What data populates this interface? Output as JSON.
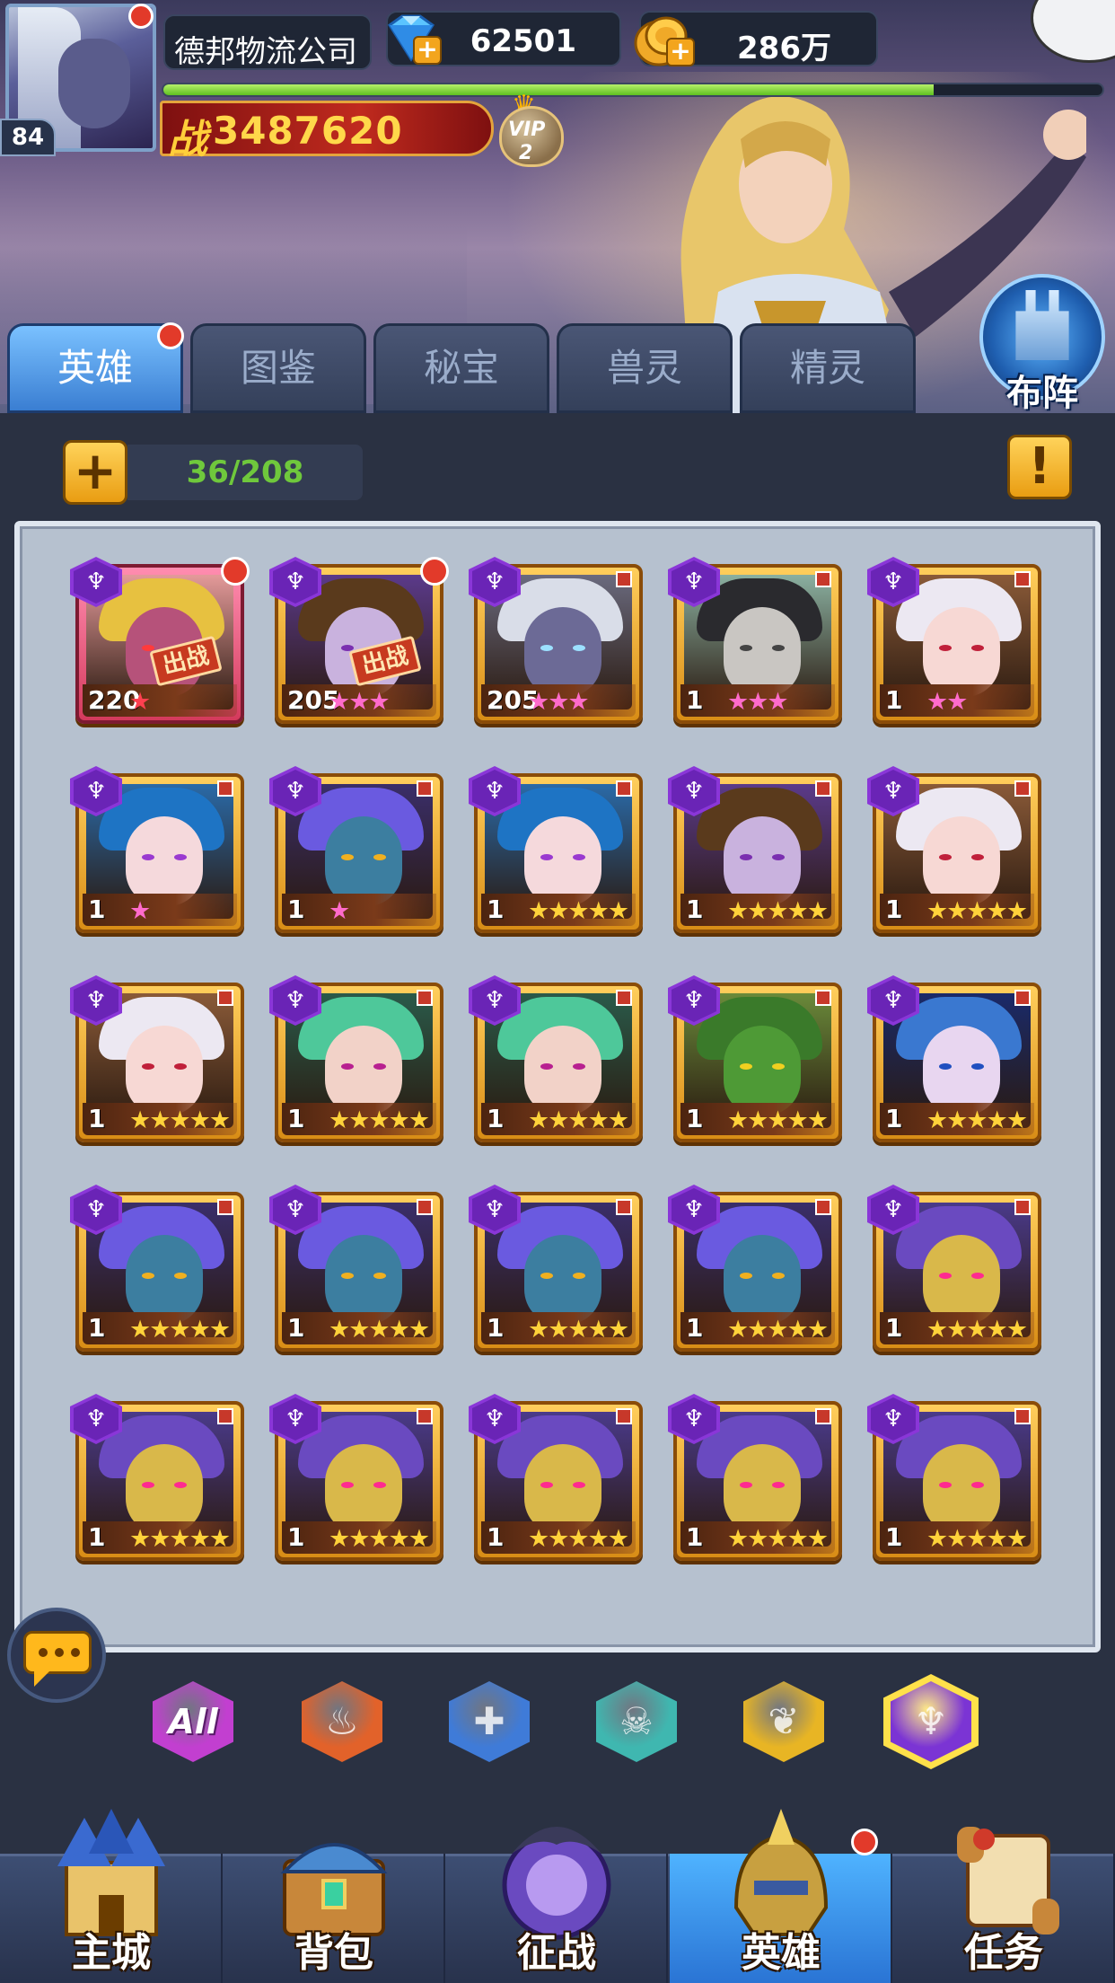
{
  "player": {
    "name": "德邦物流公司",
    "level": "84",
    "gems": "62501",
    "gold": "286万",
    "power_prefix": "战",
    "power": "3487620",
    "vip_label": "VIP",
    "vip_level": "2",
    "exp_fraction": 0.82
  },
  "tabs": [
    {
      "label": "英雄",
      "active": true,
      "badge": true
    },
    {
      "label": "图鉴",
      "active": false,
      "badge": false
    },
    {
      "label": "秘宝",
      "active": false,
      "badge": false
    },
    {
      "label": "兽灵",
      "active": false,
      "badge": false
    },
    {
      "label": "精灵",
      "active": false,
      "badge": false
    }
  ],
  "formation_label": "布阵",
  "hero_count": "36/208",
  "hero_badge_label": "出战",
  "faction_filters": [
    {
      "label": "All",
      "icon": "all-icon",
      "color": "#c23fd0",
      "selected": false
    },
    {
      "label": "",
      "icon": "fire-faction-icon",
      "color": "#e2622a",
      "selected": false
    },
    {
      "label": "",
      "icon": "cross-faction-icon",
      "color": "#3f7bd8",
      "selected": false
    },
    {
      "label": "",
      "icon": "skull-faction-icon",
      "color": "#3fb7b0",
      "selected": false
    },
    {
      "label": "",
      "icon": "wing-faction-icon",
      "color": "#e8b524",
      "selected": false
    },
    {
      "label": "",
      "icon": "trident-faction-icon",
      "color": "#7b34d4",
      "selected": true
    }
  ],
  "heroes": [
    {
      "level": "220",
      "stars": 1,
      "star_color": "#ff4050",
      "theme": "gold-masked",
      "deployed": true,
      "red_dot": true,
      "frame": "red"
    },
    {
      "level": "205",
      "stars": 3,
      "star_color": "#ff6bcb",
      "theme": "purple-warrior",
      "deployed": true,
      "red_dot": true,
      "frame": "gold"
    },
    {
      "level": "205",
      "stars": 3,
      "star_color": "#ff6bcb",
      "theme": "silver-hair",
      "deployed": false,
      "red_dot": false,
      "frame": "gold"
    },
    {
      "level": "1",
      "stars": 3,
      "star_color": "#ff6bcb",
      "theme": "dark-witch",
      "deployed": false,
      "red_dot": false,
      "frame": "gold"
    },
    {
      "level": "1",
      "stars": 2,
      "star_color": "#ff6bcb",
      "theme": "white-elf",
      "deployed": false,
      "red_dot": false,
      "frame": "gold"
    },
    {
      "level": "1",
      "stars": 1,
      "star_color": "#ff6bcb",
      "theme": "blue-hair",
      "deployed": false,
      "red_dot": false,
      "frame": "gold"
    },
    {
      "level": "1",
      "stars": 1,
      "star_color": "#ff6bcb",
      "theme": "blue-spiky",
      "deployed": false,
      "red_dot": false,
      "frame": "gold"
    },
    {
      "level": "1",
      "stars": 5,
      "star_color": "#ffd23a",
      "theme": "blue-hair",
      "deployed": false,
      "red_dot": false,
      "frame": "gold"
    },
    {
      "level": "1",
      "stars": 5,
      "star_color": "#ffd23a",
      "theme": "purple-warrior",
      "deployed": false,
      "red_dot": false,
      "frame": "gold"
    },
    {
      "level": "1",
      "stars": 5,
      "star_color": "#ffd23a",
      "theme": "white-elf",
      "deployed": false,
      "red_dot": false,
      "frame": "gold"
    },
    {
      "level": "1",
      "stars": 5,
      "star_color": "#ffd23a",
      "theme": "white-elf",
      "deployed": false,
      "red_dot": false,
      "frame": "gold"
    },
    {
      "level": "1",
      "stars": 5,
      "star_color": "#ffd23a",
      "theme": "green-hair",
      "deployed": false,
      "red_dot": false,
      "frame": "gold"
    },
    {
      "level": "1",
      "stars": 5,
      "star_color": "#ffd23a",
      "theme": "green-hair",
      "deployed": false,
      "red_dot": false,
      "frame": "gold"
    },
    {
      "level": "1",
      "stars": 5,
      "star_color": "#ffd23a",
      "theme": "toad",
      "deployed": false,
      "red_dot": false,
      "frame": "gold"
    },
    {
      "level": "1",
      "stars": 5,
      "star_color": "#ffd23a",
      "theme": "blue-crown",
      "deployed": false,
      "red_dot": false,
      "frame": "gold"
    },
    {
      "level": "1",
      "stars": 5,
      "star_color": "#ffd23a",
      "theme": "blue-spiky",
      "deployed": false,
      "red_dot": false,
      "frame": "gold"
    },
    {
      "level": "1",
      "stars": 5,
      "star_color": "#ffd23a",
      "theme": "blue-spiky",
      "deployed": false,
      "red_dot": false,
      "frame": "gold"
    },
    {
      "level": "1",
      "stars": 5,
      "star_color": "#ffd23a",
      "theme": "blue-spiky",
      "deployed": false,
      "red_dot": false,
      "frame": "gold"
    },
    {
      "level": "1",
      "stars": 5,
      "star_color": "#ffd23a",
      "theme": "blue-spiky",
      "deployed": false,
      "red_dot": false,
      "frame": "gold"
    },
    {
      "level": "1",
      "stars": 5,
      "star_color": "#ffd23a",
      "theme": "gold-mask",
      "deployed": false,
      "red_dot": false,
      "frame": "gold"
    },
    {
      "level": "1",
      "stars": 5,
      "star_color": "#ffd23a",
      "theme": "gold-mask",
      "deployed": false,
      "red_dot": false,
      "frame": "gold"
    },
    {
      "level": "1",
      "stars": 5,
      "star_color": "#ffd23a",
      "theme": "gold-mask",
      "deployed": false,
      "red_dot": false,
      "frame": "gold"
    },
    {
      "level": "1",
      "stars": 5,
      "star_color": "#ffd23a",
      "theme": "gold-mask",
      "deployed": false,
      "red_dot": false,
      "frame": "gold"
    },
    {
      "level": "1",
      "stars": 5,
      "star_color": "#ffd23a",
      "theme": "gold-mask",
      "deployed": false,
      "red_dot": false,
      "frame": "gold"
    },
    {
      "level": "1",
      "stars": 5,
      "star_color": "#ffd23a",
      "theme": "gold-mask",
      "deployed": false,
      "red_dot": false,
      "frame": "gold"
    }
  ],
  "nav": [
    {
      "label": "主城",
      "icon": "castle-icon",
      "active": false,
      "badge": false
    },
    {
      "label": "背包",
      "icon": "chest-icon",
      "active": false,
      "badge": false
    },
    {
      "label": "征战",
      "icon": "dragon-portal-icon",
      "active": false,
      "badge": false
    },
    {
      "label": "英雄",
      "icon": "helmet-icon",
      "active": true,
      "badge": true
    },
    {
      "label": "任务",
      "icon": "scroll-icon",
      "active": false,
      "badge": false
    }
  ]
}
